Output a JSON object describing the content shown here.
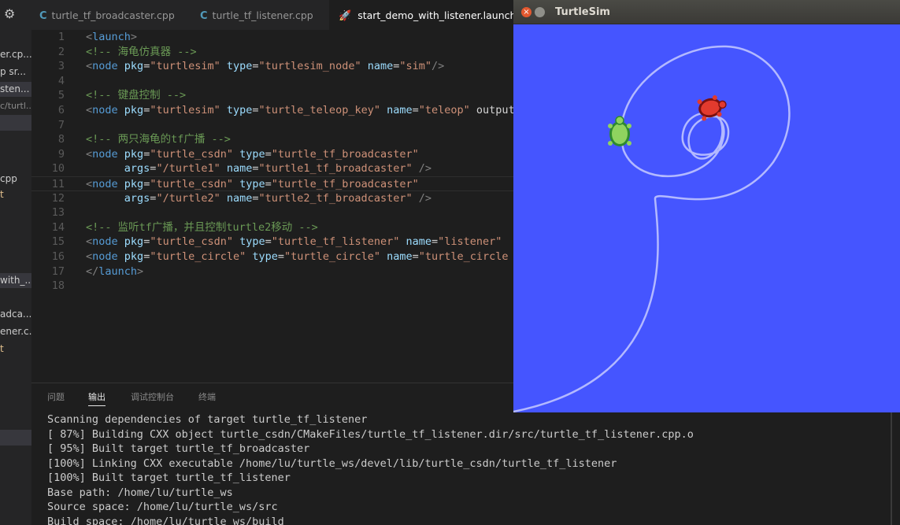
{
  "sidebar": {
    "items": [
      {
        "label": "er.cp..."
      },
      {
        "label": "p  sr..."
      },
      {
        "label": "sten..."
      },
      {
        "label": "c/turtl..."
      },
      {
        "label": "cpp"
      },
      {
        "label": "t"
      },
      {
        "label": "with_..."
      },
      {
        "label": "adca..."
      },
      {
        "label": "ener.c..."
      },
      {
        "label": "t"
      }
    ]
  },
  "tabs": [
    {
      "label": "turtle_tf_broadcaster.cpp",
      "icon": "C"
    },
    {
      "label": "turtle_tf_listener.cpp",
      "icon": "C"
    },
    {
      "label": "start_demo_with_listener.launch",
      "icon": "rocket"
    }
  ],
  "editor": {
    "line_numbers": [
      "1",
      "2",
      "3",
      "4",
      "5",
      "6",
      "7",
      "8",
      "9",
      "10",
      "11",
      "12",
      "13",
      "14",
      "15",
      "16",
      "17",
      "18"
    ],
    "lines": [
      "<launch>",
      "<!-- 海龟仿真器 -->",
      "<node pkg=\"turtlesim\" type=\"turtlesim_node\" name=\"sim\"/>",
      "",
      "<!-- 键盘控制 -->",
      "<node pkg=\"turtlesim\" type=\"turtle_teleop_key\" name=\"teleop\" output",
      "",
      "<!-- 两只海龟的tf广播 -->",
      "<node pkg=\"turtle_csdn\" type=\"turtle_tf_broadcaster\"",
      "      args=\"/turtle1\" name=\"turtle1_tf_broadcaster\" />",
      "<node pkg=\"turtle_csdn\" type=\"turtle_tf_broadcaster\"",
      "      args=\"/turtle2\" name=\"turtle2_tf_broadcaster\" />",
      "",
      "<!-- 监听tf广播，并且控制turtle2移动 -->",
      "<node pkg=\"turtle_csdn\" type=\"turtle_tf_listener\" name=\"listener\" ",
      "<node pkg=\"turtle_circle\" type=\"turtle_circle\" name=\"turtle_circle",
      "</launch>",
      ""
    ]
  },
  "panel": {
    "tabs": [
      "问题",
      "输出",
      "调试控制台",
      "终端"
    ],
    "active_tab": "输出"
  },
  "terminal": {
    "lines": [
      "Scanning dependencies of target turtle_tf_listener",
      "[ 87%] Building CXX object turtle_csdn/CMakeFiles/turtle_tf_listener.dir/src/turtle_tf_listener.cpp.o",
      "[ 95%] Built target turtle_tf_broadcaster",
      "[100%] Linking CXX executable /home/lu/turtle_ws/devel/lib/turtle_csdn/turtle_tf_listener",
      "[100%] Built target turtle_tf_listener",
      "Base path: /home/lu/turtle_ws",
      "Source space: /home/lu/turtle_ws/src",
      "Build space: /home/lu/turtle_ws/build"
    ]
  },
  "turtlesim": {
    "title": "TurtleSim",
    "background": "#4555ff",
    "trail_color": "#b3b9ff"
  },
  "colors": {
    "editor_bg": "#1e1e1e",
    "sidebar_bg": "#252526",
    "tag": "#569cd6",
    "attr": "#9cdcfe",
    "string": "#ce9178",
    "comment": "#6a9955"
  }
}
